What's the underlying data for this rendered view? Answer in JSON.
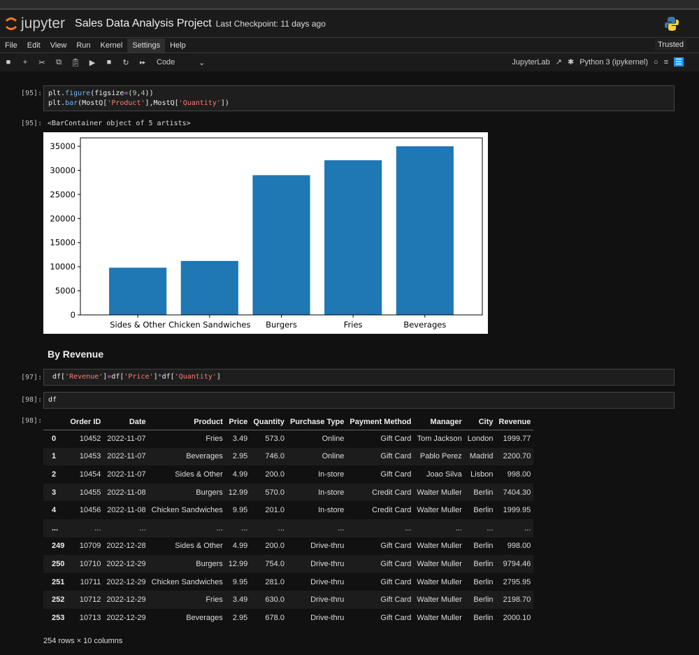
{
  "header": {
    "app_name": "jupyter",
    "notebook_title": "Sales Data Analysis Project",
    "checkpoint": "Last Checkpoint: 11 days ago"
  },
  "menu": [
    "File",
    "Edit",
    "View",
    "Run",
    "Kernel",
    "Settings",
    "Help"
  ],
  "trusted": "Trusted",
  "toolbar": {
    "cell_type": "Code",
    "jupyterlab": "JupyterLab",
    "kernel": "Python 3 (ipykernel)"
  },
  "cells": [
    {
      "prompt": "[95]:",
      "out_prompt": "[95]:",
      "output": "<BarContainer object of 5 artists>"
    },
    {
      "markdown": "By Revenue"
    },
    {
      "prompt": "[97]:"
    },
    {
      "prompt": "[98]:",
      "code": "df",
      "out_prompt": "[98]:"
    }
  ],
  "chart_data": {
    "type": "bar",
    "categories": [
      "Sides & Other",
      "Chicken Sandwiches",
      "Burgers",
      "Fries",
      "Beverages"
    ],
    "values": [
      9800,
      11200,
      29000,
      32100,
      35000
    ],
    "ylim": [
      0,
      36750
    ],
    "yticks": [
      0,
      5000,
      10000,
      15000,
      20000,
      25000,
      30000,
      35000
    ],
    "color": "#1f77b4",
    "title": "",
    "xlabel": "",
    "ylabel": "",
    "grid": false
  },
  "table": {
    "columns": [
      "",
      "Order ID",
      "Date",
      "Product",
      "Price",
      "Quantity",
      "Purchase Type",
      "Payment Method",
      "Manager",
      "City",
      "Revenue"
    ],
    "rows": [
      [
        "0",
        "10452",
        "2022-11-07",
        "Fries",
        "3.49",
        "573.0",
        "Online",
        "Gift Card",
        "Tom Jackson",
        "London",
        "1999.77"
      ],
      [
        "1",
        "10453",
        "2022-11-07",
        "Beverages",
        "2.95",
        "746.0",
        "Online",
        "Gift Card",
        "Pablo Perez",
        "Madrid",
        "2200.70"
      ],
      [
        "2",
        "10454",
        "2022-11-07",
        "Sides & Other",
        "4.99",
        "200.0",
        "In-store",
        "Gift Card",
        "Joao Silva",
        "Lisbon",
        "998.00"
      ],
      [
        "3",
        "10455",
        "2022-11-08",
        "Burgers",
        "12.99",
        "570.0",
        "In-store",
        "Credit Card",
        "Walter Muller",
        "Berlin",
        "7404.30"
      ],
      [
        "4",
        "10456",
        "2022-11-08",
        "Chicken Sandwiches",
        "9.95",
        "201.0",
        "In-store",
        "Credit Card",
        "Walter Muller",
        "Berlin",
        "1999.95"
      ],
      [
        "...",
        "...",
        "...",
        "...",
        "...",
        "...",
        "...",
        "...",
        "...",
        "...",
        "..."
      ],
      [
        "249",
        "10709",
        "2022-12-28",
        "Sides & Other",
        "4.99",
        "200.0",
        "Drive-thru",
        "Gift Card",
        "Walter Muller",
        "Berlin",
        "998.00"
      ],
      [
        "250",
        "10710",
        "2022-12-29",
        "Burgers",
        "12.99",
        "754.0",
        "Drive-thru",
        "Gift Card",
        "Walter Muller",
        "Berlin",
        "9794.46"
      ],
      [
        "251",
        "10711",
        "2022-12-29",
        "Chicken Sandwiches",
        "9.95",
        "281.0",
        "Drive-thru",
        "Gift Card",
        "Walter Muller",
        "Berlin",
        "2795.95"
      ],
      [
        "252",
        "10712",
        "2022-12-29",
        "Fries",
        "3.49",
        "630.0",
        "Drive-thru",
        "Gift Card",
        "Walter Muller",
        "Berlin",
        "2198.70"
      ],
      [
        "253",
        "10713",
        "2022-12-29",
        "Beverages",
        "2.95",
        "678.0",
        "Drive-thru",
        "Gift Card",
        "Walter Muller",
        "Berlin",
        "2000.10"
      ]
    ],
    "footer": "254 rows × 10 columns"
  }
}
